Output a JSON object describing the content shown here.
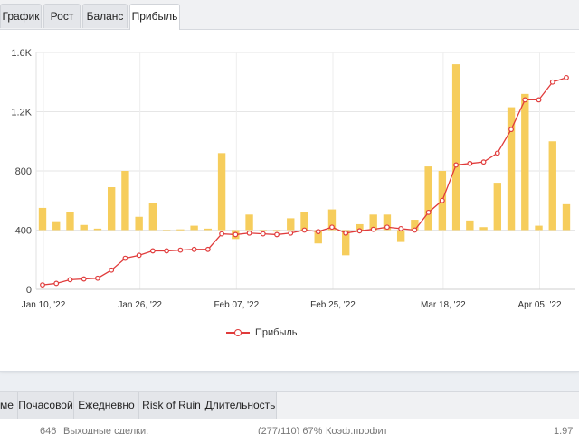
{
  "tabs": [
    {
      "label": "График",
      "active": false
    },
    {
      "label": "Рост",
      "active": false
    },
    {
      "label": "Баланс",
      "active": false
    },
    {
      "label": "Прибыль",
      "active": true
    }
  ],
  "chart_data": {
    "type": "bar+line",
    "y_tick_labels": [
      "0",
      "400",
      "800",
      "1.2K",
      "1.6K"
    ],
    "y_tick_values": [
      0,
      400,
      800,
      1200,
      1600
    ],
    "ylim": [
      0,
      1600
    ],
    "x_tick_labels": [
      "Jan 10, '22",
      "Jan 26, '22",
      "Feb 07, '22",
      "Feb 25, '22",
      "Mar 18, '22",
      "Apr 05, '22"
    ],
    "x_tick_index": [
      0,
      7,
      14,
      21,
      29,
      36
    ],
    "grid": true,
    "baseline": 400,
    "bars": [
      550,
      460,
      525,
      435,
      410,
      690,
      800,
      490,
      585,
      400,
      405,
      430,
      410,
      920,
      340,
      505,
      395,
      390,
      480,
      520,
      310,
      540,
      230,
      440,
      505,
      505,
      320,
      470,
      830,
      800,
      1520,
      465,
      420,
      720,
      1230,
      1320,
      430,
      1000,
      575
    ],
    "series": [
      {
        "name": "Прибыль",
        "color": "#e03b3b",
        "values": [
          30,
          40,
          65,
          70,
          75,
          130,
          210,
          230,
          260,
          260,
          265,
          270,
          270,
          375,
          370,
          380,
          375,
          370,
          380,
          400,
          390,
          420,
          380,
          395,
          405,
          420,
          410,
          400,
          520,
          600,
          840,
          850,
          860,
          920,
          1080,
          1280,
          1280,
          1400,
          1430
        ]
      }
    ],
    "bar_color": "#f6cd5c"
  },
  "legend": {
    "label": "Прибыль"
  },
  "bottom_tabs": [
    "ме",
    "Почасовой",
    "Ежедневно",
    "Risk of Ruin",
    "Длительность"
  ],
  "bottom_rows": [
    "646",
    "Выходные сделки:",
    "(277/110) 67%",
    "Коэф.профит",
    "1.97"
  ]
}
